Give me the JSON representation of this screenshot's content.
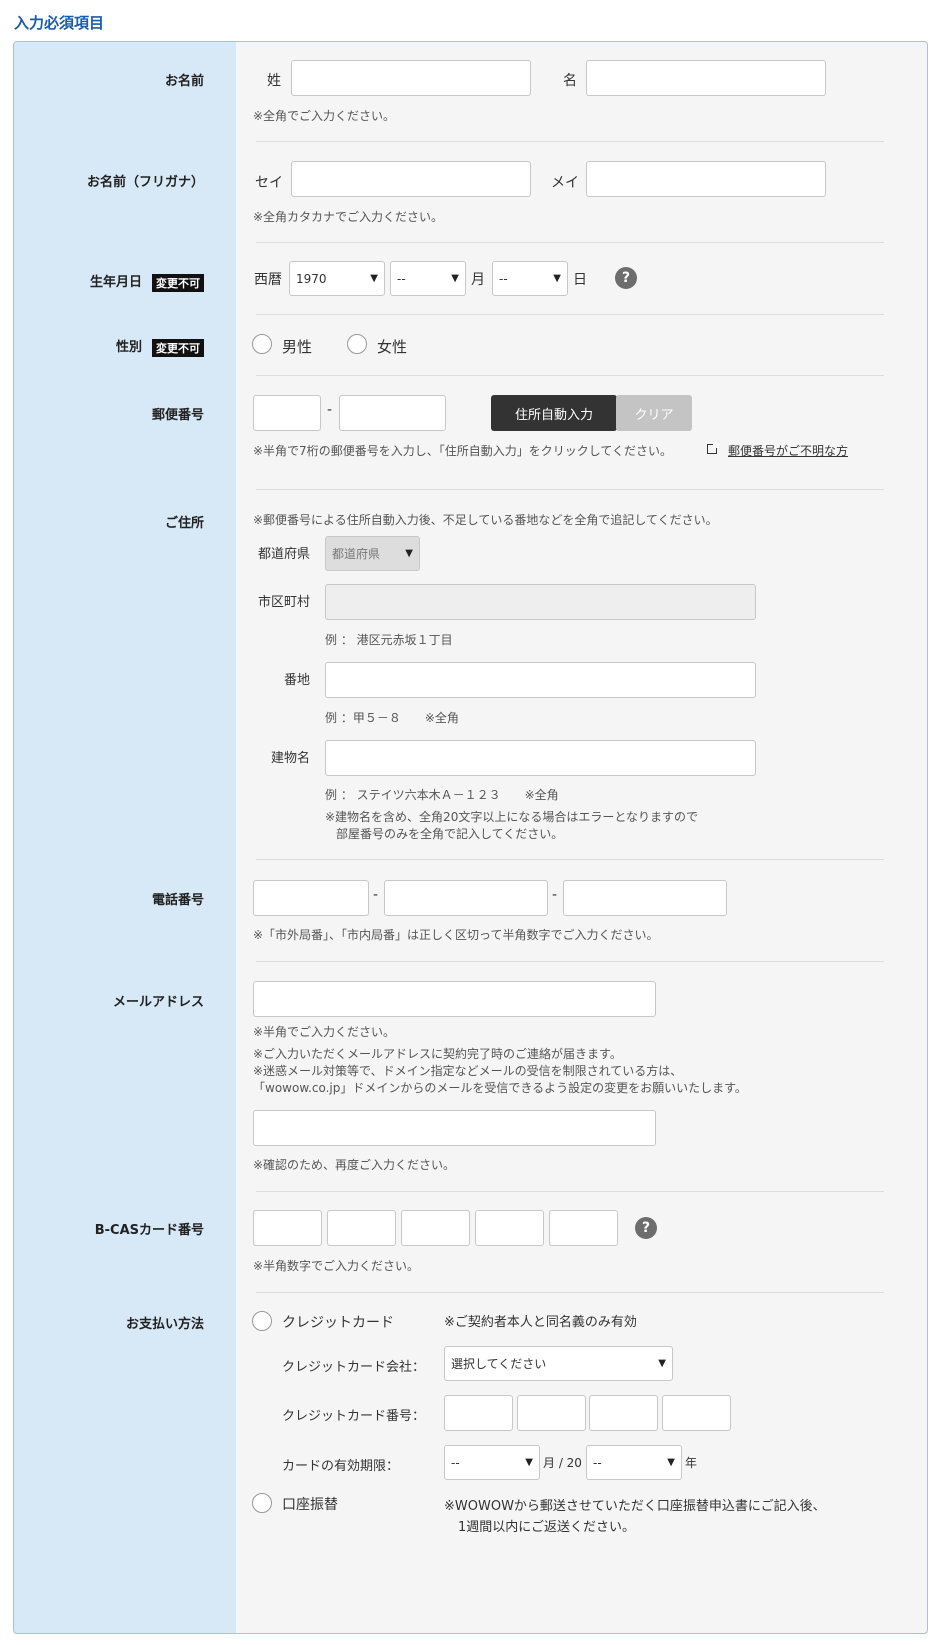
{
  "section_title": "入力必須項目",
  "fields": {
    "name": {
      "label": "お名前",
      "sei": "姓",
      "mei": "名",
      "note": "※全角でご入力ください。"
    },
    "kana": {
      "label": "お名前（フリガナ）",
      "sei": "セイ",
      "mei": "メイ",
      "note": "※全角カタカナでご入力ください。"
    },
    "birth": {
      "label": "生年月日",
      "badge": "変更不可",
      "era": "西暦",
      "year": "1970",
      "month_value": "--",
      "month_unit": "月",
      "day_value": "--",
      "day_unit": "日",
      "help": "?"
    },
    "gender": {
      "label": "性別",
      "badge": "変更不可",
      "male": "男性",
      "female": "女性"
    },
    "postal": {
      "label": "郵便番号",
      "dash": "-",
      "auto_button": "住所自動入力",
      "clear_button": "クリア",
      "note": "※半角で7桁の郵便番号を入力し、「住所自動入力」をクリックしてください。",
      "unknown_link": "郵便番号がご不明な方"
    },
    "address": {
      "label": "ご住所",
      "note": "※郵便番号による住所自動入力後、不足している番地などを全角で追記してください。",
      "pref_label": "都道府県",
      "pref_value": "都道府県",
      "city_label": "市区町村",
      "city_example": "例 ： 港区元赤坂１丁目",
      "street_label": "番地",
      "street_example": "例 ：甲５－８　　※全角",
      "building_label": "建物名",
      "building_example": "例 ： ステイツ六本木Ａ－１２３　　※全角",
      "building_note1": "※建物名を含め、全角20文字以上になる場合はエラーとなりますので",
      "building_note2": "部屋番号のみを全角で記入してください。"
    },
    "phone": {
      "label": "電話番号",
      "dash": "-",
      "note": "※「市外局番」、「市内局番」は正しく区切って半角数字でご入力ください。"
    },
    "email": {
      "label": "メールアドレス",
      "note1": "※半角でご入力ください。",
      "note2": "※ご入力いただくメールアドレスに契約完了時のご連絡が届きます。",
      "note3": "※迷惑メール対策等で、ドメイン指定などメールの受信を制限されている方は、",
      "note4": "「wowow.co.jp」ドメインからのメールを受信できるよう設定の変更をお願いいたします。",
      "confirm_note": "※確認のため、再度ご入力ください。"
    },
    "bcas": {
      "label": "B-CASカード番号",
      "note": "※半角数字でご入力ください。",
      "help": "?"
    },
    "payment": {
      "label": "お支払い方法",
      "credit": "クレジットカード",
      "credit_note": "※ご契約者本人と同名義のみ有効",
      "company_label": "クレジットカード会社：",
      "company_value": "選択してください",
      "number_label": "クレジットカード番号：",
      "expiry_label": "カードの有効期限：",
      "expiry_month": "--",
      "expiry_sep": "月 / 20",
      "expiry_year": "--",
      "expiry_unit": "年",
      "bank": "口座振替",
      "bank_note1": "※WOWOWから郵送させていただく口座振替申込書にご記入後、",
      "bank_note2": "1週間以内にご返送ください。"
    }
  }
}
